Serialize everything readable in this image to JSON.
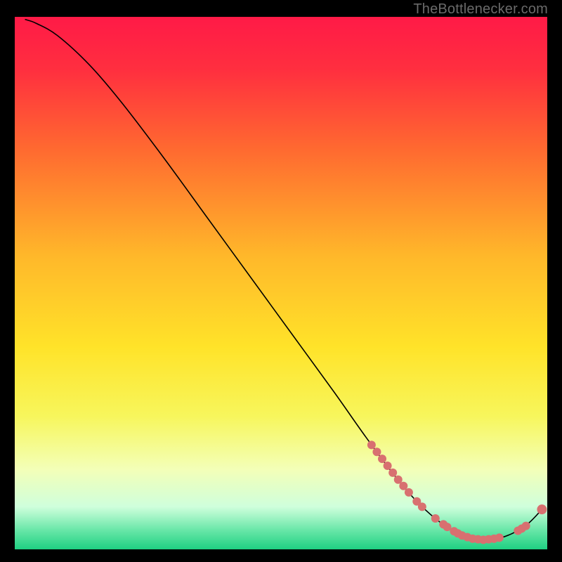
{
  "attribution": "TheBottlenecker.com",
  "chart_data": {
    "type": "line",
    "title": "",
    "xlabel": "",
    "ylabel": "",
    "xlim": [
      0,
      100
    ],
    "ylim": [
      0,
      100
    ],
    "background_gradient": [
      {
        "pos": 0.0,
        "color": "#ff1a47"
      },
      {
        "pos": 0.1,
        "color": "#ff2f3f"
      },
      {
        "pos": 0.25,
        "color": "#ff6a30"
      },
      {
        "pos": 0.45,
        "color": "#ffb82a"
      },
      {
        "pos": 0.62,
        "color": "#ffe329"
      },
      {
        "pos": 0.75,
        "color": "#f7f65c"
      },
      {
        "pos": 0.85,
        "color": "#f3ffb8"
      },
      {
        "pos": 0.92,
        "color": "#cfffdc"
      },
      {
        "pos": 0.965,
        "color": "#66e6a7"
      },
      {
        "pos": 1.0,
        "color": "#1fd082"
      }
    ],
    "curve": [
      {
        "x": 2.0,
        "y": 99.5
      },
      {
        "x": 4.0,
        "y": 98.8
      },
      {
        "x": 8.0,
        "y": 96.5
      },
      {
        "x": 14.0,
        "y": 91.0
      },
      {
        "x": 20.0,
        "y": 84.0
      },
      {
        "x": 28.0,
        "y": 73.5
      },
      {
        "x": 36.0,
        "y": 62.5
      },
      {
        "x": 44.0,
        "y": 51.5
      },
      {
        "x": 52.0,
        "y": 40.5
      },
      {
        "x": 60.0,
        "y": 29.5
      },
      {
        "x": 66.0,
        "y": 21.0
      },
      {
        "x": 72.0,
        "y": 13.0
      },
      {
        "x": 76.0,
        "y": 8.5
      },
      {
        "x": 80.0,
        "y": 5.0
      },
      {
        "x": 84.0,
        "y": 2.6
      },
      {
        "x": 88.0,
        "y": 1.8
      },
      {
        "x": 92.0,
        "y": 2.4
      },
      {
        "x": 96.0,
        "y": 4.5
      },
      {
        "x": 99.0,
        "y": 7.5
      }
    ],
    "markers": [
      {
        "x": 67.0,
        "y": 19.6
      },
      {
        "x": 68.0,
        "y": 18.3
      },
      {
        "x": 69.0,
        "y": 17.0
      },
      {
        "x": 70.0,
        "y": 15.7
      },
      {
        "x": 71.0,
        "y": 14.4
      },
      {
        "x": 72.0,
        "y": 13.1
      },
      {
        "x": 73.0,
        "y": 11.9
      },
      {
        "x": 74.0,
        "y": 10.7
      },
      {
        "x": 75.5,
        "y": 9.0
      },
      {
        "x": 76.5,
        "y": 8.0
      },
      {
        "x": 79.0,
        "y": 5.8
      },
      {
        "x": 80.5,
        "y": 4.7
      },
      {
        "x": 81.2,
        "y": 4.2
      },
      {
        "x": 82.5,
        "y": 3.4
      },
      {
        "x": 83.2,
        "y": 3.0
      },
      {
        "x": 84.0,
        "y": 2.6
      },
      {
        "x": 85.0,
        "y": 2.3
      },
      {
        "x": 86.0,
        "y": 2.0
      },
      {
        "x": 87.0,
        "y": 1.9
      },
      {
        "x": 88.0,
        "y": 1.8
      },
      {
        "x": 89.0,
        "y": 1.9
      },
      {
        "x": 90.0,
        "y": 2.0
      },
      {
        "x": 91.0,
        "y": 2.2
      },
      {
        "x": 94.5,
        "y": 3.5
      },
      {
        "x": 95.2,
        "y": 3.9
      },
      {
        "x": 96.0,
        "y": 4.4
      },
      {
        "x": 99.0,
        "y": 7.5
      }
    ],
    "marker_style": {
      "color": "#d87070",
      "radius_small": 6,
      "radius_large": 7
    },
    "curve_style": {
      "color": "#000000",
      "width": 1.6
    }
  }
}
